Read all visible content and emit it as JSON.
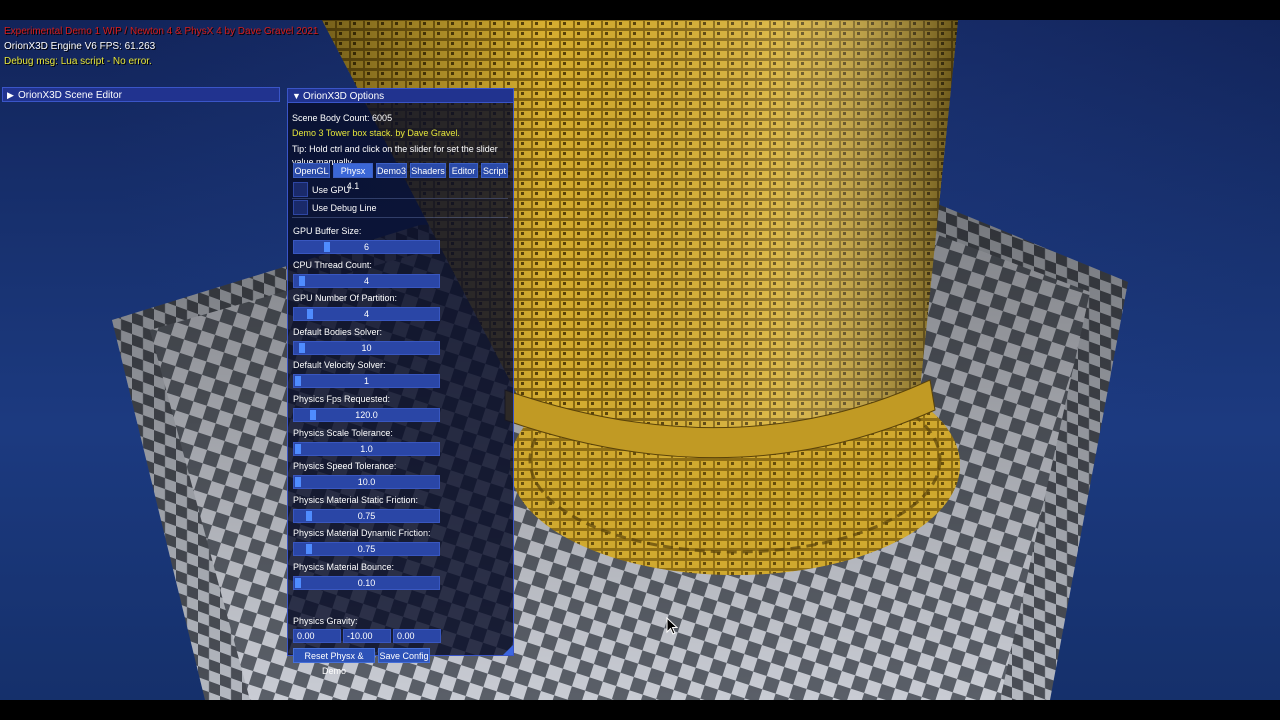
{
  "hud": {
    "title_line": "Experimental Demo 1 WIP / Newton 4 & PhysX 4 by Dave Gravel 2021",
    "fps_line": "OrionX3D Engine V6 FPS: 61.263",
    "debug_line": "Debug msg: Lua script - No error."
  },
  "scene_editor": {
    "title": "OrionX3D Scene Editor"
  },
  "options": {
    "title": "OrionX3D Options",
    "body_count": "Scene Body Count: 6005",
    "demo_line": "Demo 3 Tower box stack. by Dave Gravel.",
    "tip_line": "Tip: Hold ctrl and click on the slider for set the slider value manually.",
    "tabs": [
      {
        "label": "OpenGL"
      },
      {
        "label": "Physx 4.1"
      },
      {
        "label": "Demo3"
      },
      {
        "label": "Shaders"
      },
      {
        "label": "Editor"
      },
      {
        "label": "Script"
      }
    ],
    "active_tab": "Physx 4.1",
    "checkboxes": [
      {
        "label": "Use GPU",
        "checked": false
      },
      {
        "label": "Use Debug Line",
        "checked": false
      }
    ],
    "sliders": [
      {
        "label": "GPU Buffer Size:",
        "value": "6",
        "fraction": 0.21
      },
      {
        "label": "CPU Thread Count:",
        "value": "4",
        "fraction": 0.03
      },
      {
        "label": "GPU Number Of Partition:",
        "value": "4",
        "fraction": 0.09
      },
      {
        "label": "Default Bodies Solver:",
        "value": "10",
        "fraction": 0.03
      },
      {
        "label": "Default Velocity Solver:",
        "value": "1",
        "fraction": 0.0
      },
      {
        "label": "Physics Fps Requested:",
        "value": "120.0",
        "fraction": 0.11
      },
      {
        "label": "Physics Scale Tolerance:",
        "value": "1.0",
        "fraction": 0.0
      },
      {
        "label": "Physics Speed Tolerance:",
        "value": "10.0",
        "fraction": 0.0
      },
      {
        "label": "Physics Material Static Friction:",
        "value": "0.75",
        "fraction": 0.08
      },
      {
        "label": "Physics Material Dynamic Friction:",
        "value": "0.75",
        "fraction": 0.08
      },
      {
        "label": "Physics Material Bounce:",
        "value": "0.10",
        "fraction": 0.0
      }
    ],
    "gravity": {
      "label": "Physics Gravity:",
      "x": "0.00",
      "y": "-10.00",
      "z": "0.00"
    },
    "buttons": {
      "reset": "Reset Physx & Demo",
      "save": "Save Config"
    }
  },
  "colors": {
    "hud_title": "#d61c1c",
    "hud_fps": "#ffffff",
    "hud_debug": "#e6e63a",
    "panel_header": "#21338f",
    "slider_track": "#2a46a6",
    "slider_grab": "#4f8cff",
    "tower_gold": "#c9a22a",
    "water": "#1c3a80"
  }
}
